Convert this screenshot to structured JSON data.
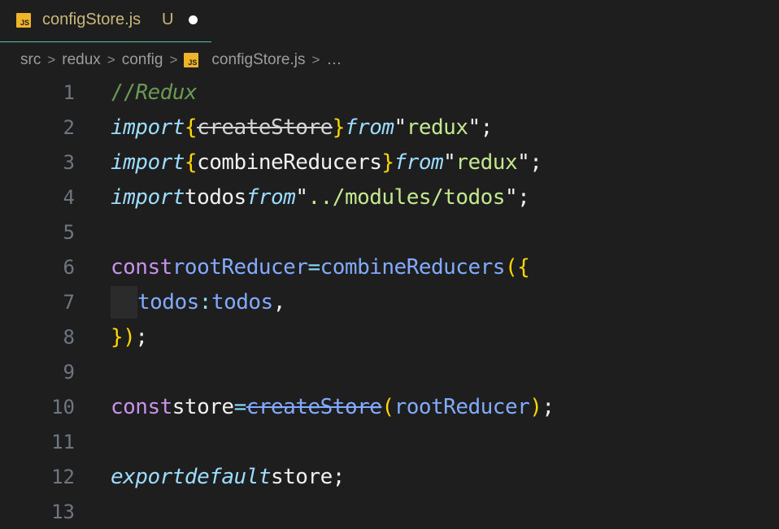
{
  "tab": {
    "icon": "JS",
    "title": "configStore.js",
    "status": "U"
  },
  "breadcrumb": {
    "items": [
      "src",
      "redux",
      "config"
    ],
    "file_icon": "JS",
    "file": "configStore.js",
    "more": "…"
  },
  "editor": {
    "line_numbers": [
      "1",
      "2",
      "3",
      "4",
      "5",
      "6",
      "7",
      "8",
      "9",
      "10",
      "11",
      "12",
      "13"
    ],
    "l1": {
      "slashes": "//",
      "text": "Redux"
    },
    "l2": {
      "import": "import",
      "open": "{",
      "name": "createStore",
      "close": "}",
      "from": "from",
      "q1": "\"",
      "mod": "redux",
      "q2": "\"",
      "semi": ";"
    },
    "l3": {
      "import": "import",
      "open": "{",
      "name": "combineReducers",
      "close": "}",
      "from": "from",
      "q1": "\"",
      "mod": "redux",
      "q2": "\"",
      "semi": ";"
    },
    "l4": {
      "import": "import",
      "name": "todos",
      "from": "from",
      "q1": "\"",
      "mod": "../modules/todos",
      "q2": "\"",
      "semi": ";"
    },
    "l6": {
      "kw": "const",
      "var": "rootReducer",
      "eq": "=",
      "fn": "combineReducers",
      "open": "({"
    },
    "l7": {
      "key": "todos",
      "colon": ":",
      "val": "todos",
      "comma": ","
    },
    "l8": {
      "close": "})",
      "semi": ";"
    },
    "l10": {
      "kw": "const",
      "var": "store",
      "eq": "=",
      "fn": "createStore",
      "open": "(",
      "arg": "rootReducer",
      "close": ")",
      "semi": ";"
    },
    "l12": {
      "export": "export",
      "default": "default",
      "name": "store",
      "semi": ";"
    }
  }
}
